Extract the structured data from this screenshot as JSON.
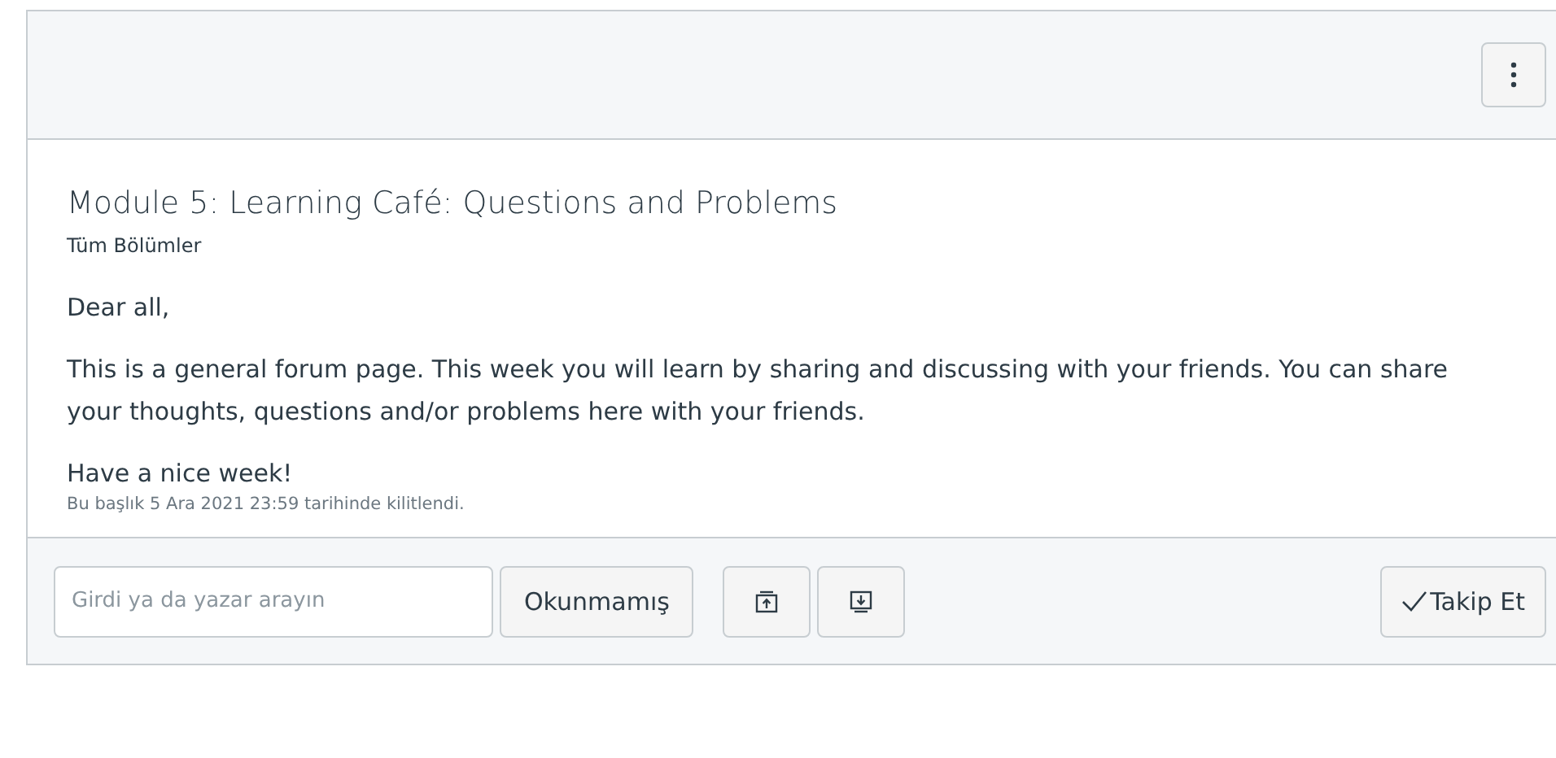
{
  "topic": {
    "title": "Module 5: Learning Café: Questions and Problems",
    "section": "Tüm Bölümler",
    "paragraphs": [
      "Dear all,",
      "This is a general forum page. This week you will learn by sharing and discussing with your friends. You can share your thoughts, questions and/or problems here with your friends.",
      "Have a nice week!"
    ],
    "lock_note": "Bu başlık 5 Ara 2021 23:59 tarihinde kilitlendi."
  },
  "toolbar": {
    "search": {
      "placeholder": "Girdi ya da yazar arayın"
    },
    "unread_button": "Okunmamış",
    "follow_button": "Takip Et"
  }
}
